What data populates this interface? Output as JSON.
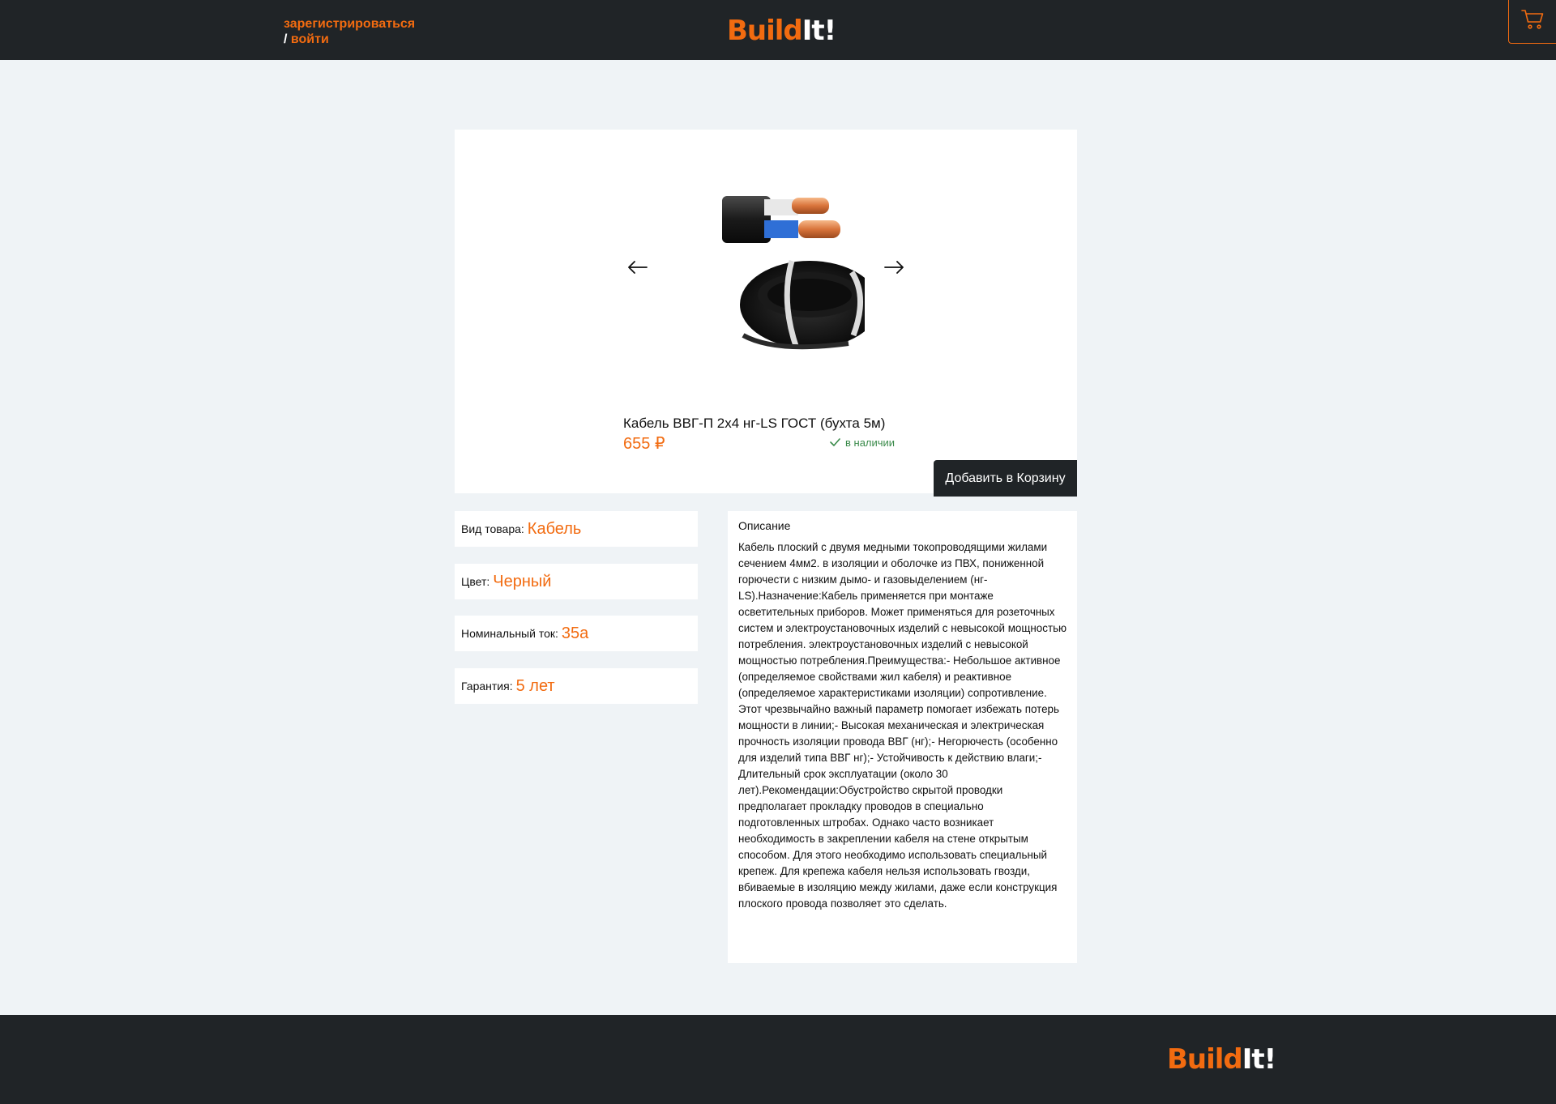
{
  "header": {
    "register_label": "зарегистрироваться",
    "slash": "/",
    "login_label": "войти",
    "logo_build": "Build",
    "logo_it": "It!",
    "cart_icon": "cart-icon"
  },
  "product": {
    "title": "Кабель ВВГ-П 2х4 нг-LS ГОСТ (бухта 5м)",
    "price": "655 ₽",
    "stock": "в наличии",
    "add_to_cart_label": "Добавить в Корзину",
    "prev_icon": "arrow-left-icon",
    "next_icon": "arrow-right-icon"
  },
  "specs": [
    {
      "label": "Вид товара:",
      "value": "Кабель"
    },
    {
      "label": "Цвет:",
      "value": "Черный"
    },
    {
      "label": "Номинальный ток:",
      "value": "35а"
    },
    {
      "label": "Гарантия:",
      "value": "5 лет"
    }
  ],
  "description": {
    "heading": "Описание",
    "text": "Кабель плоский с двумя медными токопроводящими жилами сечением 4мм2. в изоляции и оболочке из ПВХ, пониженной горючести с низким дымо- и газовыделением (нг-LS).Назначение:Кабель применяется при монтаже осветительных приборов. Может применяться для розеточных систем и электроустановочных изделий с невысокой мощностью потребления. электроустановочных изделий с невысокой мощностью потребления.Преимущества:- Небольшое активное (определяемое свойствами жил кабеля) и реактивное (определяемое характеристиками изоляции) сопротивление. Этот чрезвычайно важный параметр помогает избежать потерь мощности в линии;- Высокая механическая и электрическая прочность изоляции провода ВВГ (нг);- Негорючесть (особенно для изделий типа ВВГ нг);- Устойчивость к действию влаги;- Длительный срок эксплуатации (около 30 лет).Рекомендации:Обустройство скрытой проводки предполагает прокладку проводов в специально подготовленных штробах. Однако часто возникает необходимость в закреплении кабеля на стене открытым способом. Для этого необходимо использовать специальный крепеж. Для крепежа кабеля нельзя использовать гвозди, вбиваемые в изоляцию между жилами, даже если конструкция плоского провода позволяет это сделать."
  },
  "footer": {
    "logo_build": "Build",
    "logo_it": "It!"
  },
  "colors": {
    "accent": "#f26b10",
    "dark": "#202427",
    "background": "#eff3f6",
    "in_stock": "#3a8a4a"
  }
}
